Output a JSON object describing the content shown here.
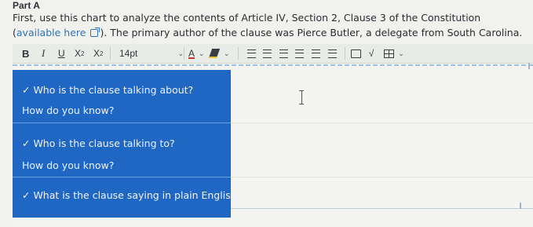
{
  "part_label": "Part A",
  "instructions": {
    "text_before": "First, use this chart to analyze the contents of Article IV, Section 2, Clause 3 of the Constitution (",
    "link_text": "available here",
    "text_after": "). The primary author of the clause was Pierce Butler, a delegate from South Carolina."
  },
  "toolbar": {
    "bold": "B",
    "italic": "I",
    "underline": "U",
    "superscript": "X",
    "superscript_mark": "2",
    "subscript": "X",
    "subscript_mark": "2",
    "font_size": "14pt",
    "font_color": "A",
    "caret": "⌄",
    "sqrt": "√"
  },
  "editor": {
    "rows": [
      {
        "question": "✓ Who is the clause talking about?"
      },
      {
        "question": "How do you know?"
      },
      {
        "question": "✓ Who is the clause talking to?"
      },
      {
        "question": "How do you know?"
      },
      {
        "question": "✓ What is the clause saying in plain English?"
      }
    ]
  },
  "colors": {
    "panel": "#1f67c2",
    "link": "#2d73b8",
    "background": "#f1f2ee"
  }
}
